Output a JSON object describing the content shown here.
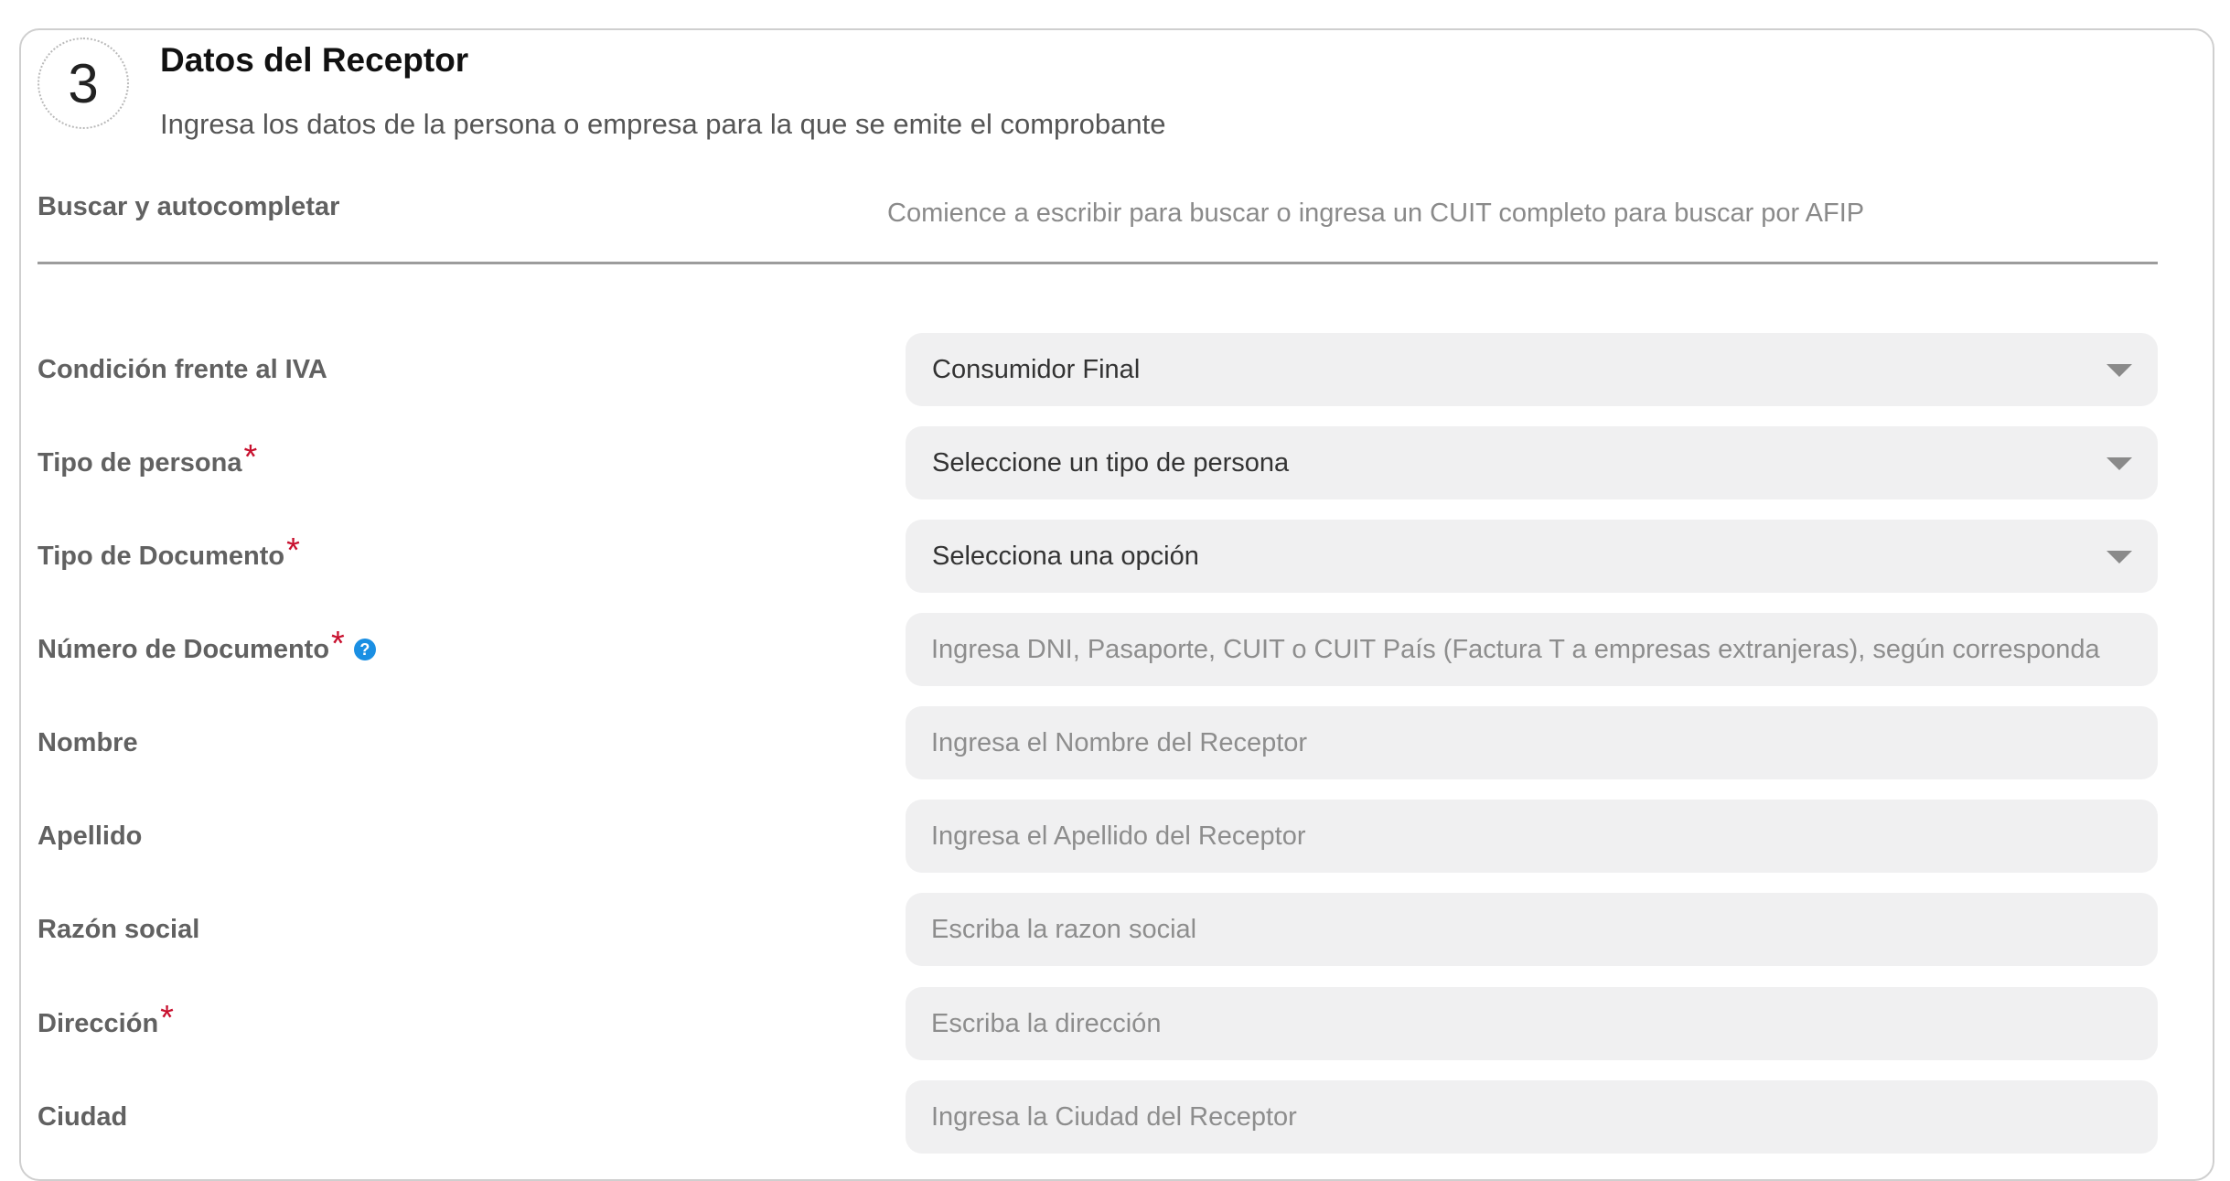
{
  "section": {
    "step_number": "3",
    "title": "Datos del Receptor",
    "subtitle": "Ingresa los datos de la persona o empresa para la que se emite el comprobante"
  },
  "search": {
    "label": "Buscar y autocompletar",
    "placeholder": "Comience a escribir para buscar o ingresa un CUIT completo para buscar por AFIP"
  },
  "fields": {
    "iva": {
      "label": "Condición frente al IVA",
      "value": "Consumidor Final"
    },
    "tipo_persona": {
      "label": "Tipo de persona",
      "required_mark": "*",
      "value": "Seleccione un tipo de persona"
    },
    "tipo_documento": {
      "label": "Tipo de Documento",
      "required_mark": "*",
      "value": "Selecciona una opción"
    },
    "numero_documento": {
      "label": "Número de Documento",
      "required_mark": "*",
      "help_glyph": "?",
      "placeholder": "Ingresa DNI, Pasaporte, CUIT o CUIT País (Factura T a empresas extranjeras), según corresponda"
    },
    "nombre": {
      "label": "Nombre",
      "placeholder": "Ingresa el Nombre del Receptor"
    },
    "apellido": {
      "label": "Apellido",
      "placeholder": "Ingresa el Apellido del Receptor"
    },
    "razon_social": {
      "label": "Razón social",
      "placeholder": "Escriba la razon social"
    },
    "direccion": {
      "label": "Dirección",
      "required_mark": "*",
      "placeholder": "Escriba la dirección"
    },
    "ciudad": {
      "label": "Ciudad",
      "placeholder": "Ingresa la Ciudad del Receptor"
    }
  },
  "colors": {
    "required": "#c8102e",
    "help_icon": "#1a8fe3",
    "field_bg": "#f0f0f1",
    "label_text": "#616161"
  },
  "icons": {
    "dropdown": "chevron-down-icon",
    "help": "help-icon"
  }
}
